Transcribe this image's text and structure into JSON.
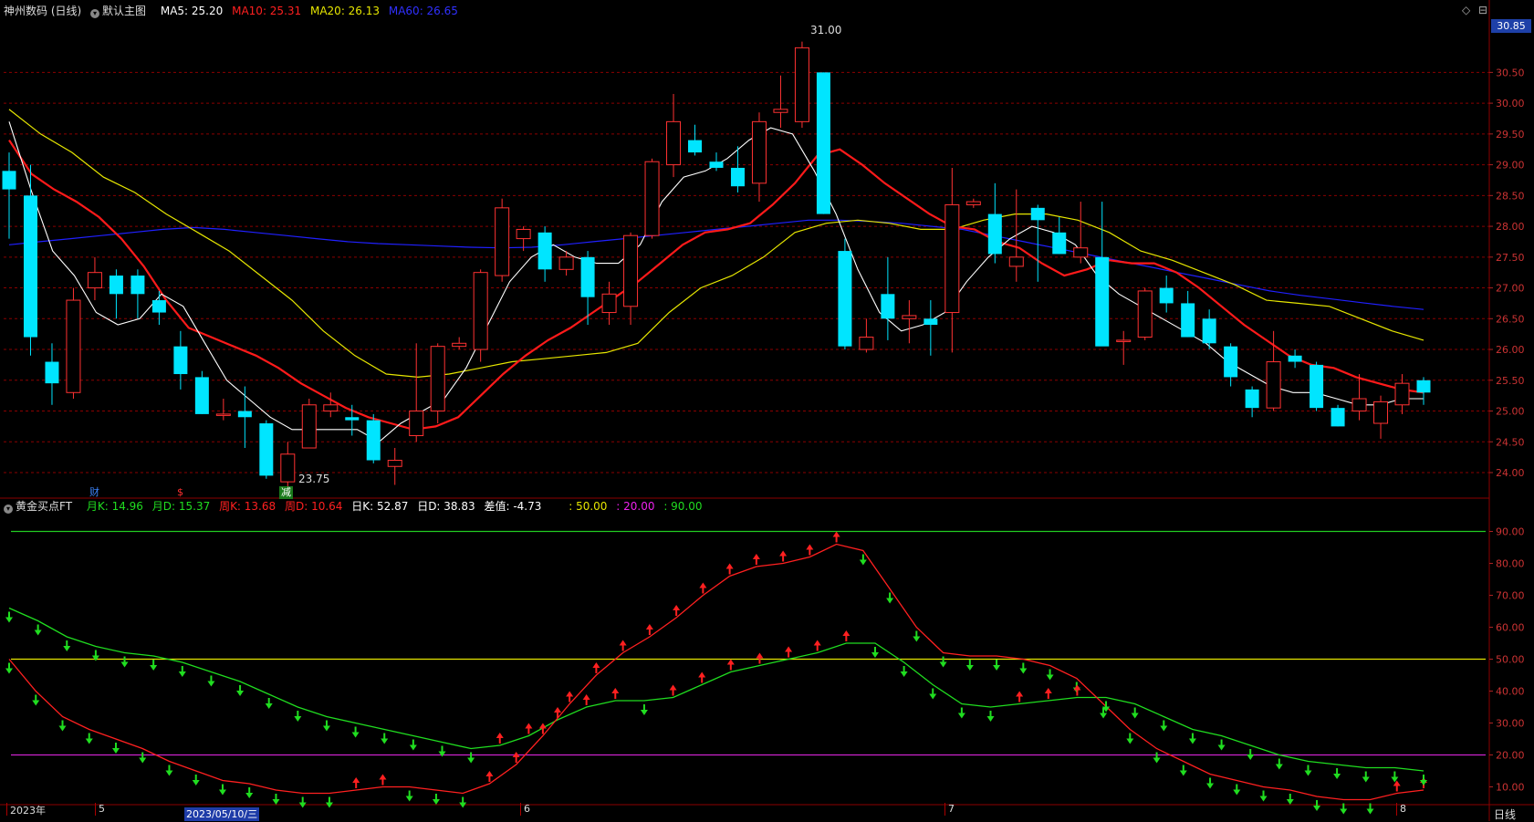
{
  "header": {
    "stock_name": "神州数码 (日线)",
    "main_chart_label": "默认主图",
    "ma5": "MA5: 25.20",
    "ma10": "MA10: 25.31",
    "ma20": "MA20: 26.13",
    "ma60": "MA60: 26.65"
  },
  "indicator_legend": {
    "name": "黄金买点FT",
    "monthly_k": "月K: 14.96",
    "monthly_d": "月D: 15.37",
    "weekly_k": "周K: 13.68",
    "weekly_d": "周D: 10.64",
    "daily_k": "日K: 52.87",
    "daily_d": "日D: 38.83",
    "diff": "差值: -4.73",
    "lvl50": ": 50.00",
    "lvl20": ": 20.00",
    "lvl90": ": 90.00"
  },
  "right_panel": {
    "current_price": "30.85",
    "period": "日线",
    "top_icons": [
      "◇",
      "⊟"
    ]
  },
  "annotations": {
    "high_label": "31.00",
    "low_label": "23.75",
    "badges": [
      {
        "text": "财",
        "color": "#3b82f6"
      },
      {
        "text": "$",
        "color": "#ff3030"
      },
      {
        "text": "减",
        "color": "#22cc22"
      }
    ]
  },
  "time_axis": {
    "labels": [
      "2023年",
      "5",
      "6",
      "7",
      "8"
    ],
    "selected_date": "2023/05/10/三"
  },
  "colors": {
    "up": "#ff3232",
    "down": "#00e5ff",
    "ma5": "#ffffff",
    "ma10": "#ff1a1a",
    "ma20": "#e6e600",
    "ma60": "#2020ff",
    "kd_red": "#ff2020",
    "kd_green": "#20dd20",
    "level50": "#e6e600",
    "level20": "#cc22cc",
    "level90": "#22cc22",
    "grid": "#8b0000"
  },
  "chart_data": [
    {
      "type": "candlestick",
      "title": "神州数码 (日线)",
      "price_axis_ticks": [
        24.0,
        24.5,
        25.0,
        25.5,
        26.0,
        26.5,
        27.0,
        27.5,
        28.0,
        28.5,
        29.0,
        29.5,
        30.0,
        30.5
      ],
      "ylim": [
        23.6,
        31.35
      ],
      "candles": [
        {
          "o": 28.9,
          "h": 29.2,
          "l": 27.8,
          "c": 28.6
        },
        {
          "o": 28.5,
          "h": 29.0,
          "l": 25.9,
          "c": 26.2
        },
        {
          "o": 25.8,
          "h": 26.1,
          "l": 25.1,
          "c": 25.45
        },
        {
          "o": 25.3,
          "h": 27.0,
          "l": 25.2,
          "c": 26.8
        },
        {
          "o": 27.0,
          "h": 27.5,
          "l": 26.8,
          "c": 27.25
        },
        {
          "o": 27.2,
          "h": 27.3,
          "l": 26.5,
          "c": 26.9
        },
        {
          "o": 27.2,
          "h": 27.3,
          "l": 26.5,
          "c": 26.9
        },
        {
          "o": 26.8,
          "h": 26.95,
          "l": 26.4,
          "c": 26.6
        },
        {
          "o": 26.05,
          "h": 26.3,
          "l": 25.35,
          "c": 25.6
        },
        {
          "o": 25.55,
          "h": 25.65,
          "l": 24.95,
          "c": 24.95
        },
        {
          "o": 24.95,
          "h": 25.2,
          "l": 24.85,
          "c": 24.95
        },
        {
          "o": 25.0,
          "h": 25.4,
          "l": 24.4,
          "c": 24.9
        },
        {
          "o": 24.8,
          "h": 24.85,
          "l": 23.9,
          "c": 23.95
        },
        {
          "o": 23.85,
          "h": 24.5,
          "l": 23.75,
          "c": 24.3
        },
        {
          "o": 24.4,
          "h": 25.2,
          "l": 24.4,
          "c": 25.1
        },
        {
          "o": 25.0,
          "h": 25.3,
          "l": 24.9,
          "c": 25.1
        },
        {
          "o": 24.9,
          "h": 25.1,
          "l": 24.6,
          "c": 24.85
        },
        {
          "o": 24.85,
          "h": 24.95,
          "l": 24.15,
          "c": 24.2
        },
        {
          "o": 24.1,
          "h": 24.4,
          "l": 23.8,
          "c": 24.2
        },
        {
          "o": 24.6,
          "h": 26.1,
          "l": 24.5,
          "c": 25.0
        },
        {
          "o": 25.0,
          "h": 26.1,
          "l": 24.8,
          "c": 26.05
        },
        {
          "o": 26.05,
          "h": 26.2,
          "l": 26.0,
          "c": 26.1
        },
        {
          "o": 26.0,
          "h": 27.3,
          "l": 25.8,
          "c": 27.25
        },
        {
          "o": 27.2,
          "h": 28.45,
          "l": 27.1,
          "c": 28.3
        },
        {
          "o": 27.8,
          "h": 28.0,
          "l": 27.6,
          "c": 27.95
        },
        {
          "o": 27.9,
          "h": 28.0,
          "l": 27.1,
          "c": 27.3
        },
        {
          "o": 27.3,
          "h": 27.6,
          "l": 27.2,
          "c": 27.5
        },
        {
          "o": 27.5,
          "h": 27.6,
          "l": 26.4,
          "c": 26.85
        },
        {
          "o": 26.6,
          "h": 27.1,
          "l": 26.4,
          "c": 26.9
        },
        {
          "o": 26.7,
          "h": 27.9,
          "l": 26.4,
          "c": 27.85
        },
        {
          "o": 27.85,
          "h": 29.1,
          "l": 27.8,
          "c": 29.05
        },
        {
          "o": 29.0,
          "h": 30.15,
          "l": 28.8,
          "c": 29.7
        },
        {
          "o": 29.4,
          "h": 29.65,
          "l": 29.15,
          "c": 29.2
        },
        {
          "o": 29.05,
          "h": 29.2,
          "l": 28.9,
          "c": 28.95
        },
        {
          "o": 28.95,
          "h": 29.3,
          "l": 28.55,
          "c": 28.65
        },
        {
          "o": 28.7,
          "h": 29.85,
          "l": 28.4,
          "c": 29.7
        },
        {
          "o": 29.85,
          "h": 30.45,
          "l": 29.6,
          "c": 29.9
        },
        {
          "o": 29.7,
          "h": 31.0,
          "l": 29.6,
          "c": 30.9
        },
        {
          "o": 30.5,
          "h": 30.5,
          "l": 28.2,
          "c": 28.2
        },
        {
          "o": 27.6,
          "h": 27.8,
          "l": 26.0,
          "c": 26.05
        },
        {
          "o": 26.0,
          "h": 26.5,
          "l": 25.95,
          "c": 26.2
        },
        {
          "o": 26.9,
          "h": 27.5,
          "l": 26.15,
          "c": 26.5
        },
        {
          "o": 26.5,
          "h": 26.8,
          "l": 26.1,
          "c": 26.55
        },
        {
          "o": 26.5,
          "h": 26.8,
          "l": 25.9,
          "c": 26.4
        },
        {
          "o": 26.6,
          "h": 28.95,
          "l": 25.95,
          "c": 28.35
        },
        {
          "o": 28.35,
          "h": 28.45,
          "l": 28.3,
          "c": 28.4
        },
        {
          "o": 28.2,
          "h": 28.7,
          "l": 27.4,
          "c": 27.55
        },
        {
          "o": 27.35,
          "h": 28.6,
          "l": 27.1,
          "c": 27.5
        },
        {
          "o": 28.3,
          "h": 28.35,
          "l": 27.1,
          "c": 28.1
        },
        {
          "o": 27.9,
          "h": 28.15,
          "l": 27.55,
          "c": 27.55
        },
        {
          "o": 27.5,
          "h": 28.4,
          "l": 27.4,
          "c": 27.65
        },
        {
          "o": 27.5,
          "h": 28.4,
          "l": 27.4,
          "c": 26.05
        },
        {
          "o": 26.15,
          "h": 26.3,
          "l": 25.75,
          "c": 26.15
        },
        {
          "o": 26.2,
          "h": 27.0,
          "l": 26.15,
          "c": 26.95
        },
        {
          "o": 27.0,
          "h": 27.2,
          "l": 26.6,
          "c": 26.75
        },
        {
          "o": 26.75,
          "h": 26.95,
          "l": 26.2,
          "c": 26.2
        },
        {
          "o": 26.5,
          "h": 26.65,
          "l": 26.0,
          "c": 26.1
        },
        {
          "o": 26.05,
          "h": 26.1,
          "l": 25.4,
          "c": 25.55
        },
        {
          "o": 25.35,
          "h": 25.4,
          "l": 24.9,
          "c": 25.05
        },
        {
          "o": 25.05,
          "h": 26.3,
          "l": 25.0,
          "c": 25.8
        },
        {
          "o": 25.9,
          "h": 26.0,
          "l": 25.7,
          "c": 25.8
        },
        {
          "o": 25.75,
          "h": 25.8,
          "l": 25.0,
          "c": 25.05
        },
        {
          "o": 25.05,
          "h": 25.1,
          "l": 24.75,
          "c": 24.75
        },
        {
          "o": 25.0,
          "h": 25.6,
          "l": 24.85,
          "c": 25.2
        },
        {
          "o": 24.8,
          "h": 25.25,
          "l": 24.55,
          "c": 25.15
        },
        {
          "o": 25.1,
          "h": 25.6,
          "l": 24.95,
          "c": 25.45
        },
        {
          "o": 25.5,
          "h": 25.55,
          "l": 25.1,
          "c": 25.3
        }
      ],
      "ma5": [
        29.7,
        28.6,
        27.6,
        27.2,
        26.6,
        26.4,
        26.5,
        26.9,
        26.7,
        26.1,
        25.5,
        25.2,
        24.9,
        24.7,
        24.7,
        24.7,
        24.7,
        24.5,
        24.8,
        25.0,
        25.2,
        25.7,
        26.4,
        27.1,
        27.5,
        27.7,
        27.5,
        27.4,
        27.4,
        27.7,
        28.4,
        28.8,
        28.9,
        29.1,
        29.4,
        29.6,
        29.5,
        28.9,
        28.2,
        27.3,
        26.6,
        26.3,
        26.4,
        26.6,
        27.1,
        27.5,
        27.8,
        28.0,
        27.9,
        27.7,
        27.2,
        26.9,
        26.7,
        26.5,
        26.3,
        26.1,
        25.8,
        25.6,
        25.4,
        25.3,
        25.3,
        25.2,
        25.1,
        25.1,
        25.2,
        25.2
      ],
      "ma10": [
        29.4,
        28.85,
        28.6,
        28.4,
        28.15,
        27.8,
        27.35,
        26.8,
        26.35,
        26.2,
        26.05,
        25.9,
        25.7,
        25.45,
        25.25,
        25.05,
        24.9,
        24.8,
        24.7,
        24.75,
        24.9,
        25.25,
        25.6,
        25.9,
        26.15,
        26.35,
        26.6,
        26.85,
        27.1,
        27.4,
        27.7,
        27.9,
        27.95,
        28.05,
        28.35,
        28.7,
        29.15,
        29.25,
        29.0,
        28.7,
        28.45,
        28.2,
        28.0,
        27.95,
        27.75,
        27.65,
        27.4,
        27.2,
        27.3,
        27.45,
        27.4,
        27.4,
        27.25,
        27.0,
        26.7,
        26.4,
        26.15,
        25.9,
        25.75,
        25.7,
        25.55,
        25.45,
        25.35,
        25.3
      ],
      "ma20": [
        29.9,
        29.5,
        29.2,
        28.8,
        28.55,
        28.2,
        27.9,
        27.6,
        27.2,
        26.8,
        26.3,
        25.9,
        25.6,
        25.55,
        25.6,
        25.7,
        25.8,
        25.85,
        25.9,
        25.95,
        26.1,
        26.6,
        27.0,
        27.2,
        27.5,
        27.9,
        28.05,
        28.1,
        28.05,
        27.95,
        27.95,
        28.1,
        28.2,
        28.2,
        28.1,
        27.9,
        27.6,
        27.45,
        27.25,
        27.05,
        26.8,
        26.75,
        26.7,
        26.5,
        26.3,
        26.15
      ],
      "ma60": [
        27.7,
        27.75,
        27.8,
        27.85,
        27.9,
        27.95,
        27.98,
        27.95,
        27.9,
        27.85,
        27.8,
        27.75,
        27.72,
        27.7,
        27.68,
        27.66,
        27.65,
        27.66,
        27.7,
        27.75,
        27.8,
        27.85,
        27.9,
        27.95,
        28.0,
        28.05,
        28.1,
        28.1,
        28.08,
        28.05,
        28.0,
        27.95,
        27.85,
        27.75,
        27.65,
        27.55,
        27.45,
        27.35,
        27.25,
        27.15,
        27.05,
        26.95,
        26.88,
        26.82,
        26.76,
        26.7,
        26.65
      ]
    },
    {
      "type": "line",
      "title": "黄金买点FT",
      "ylim": [
        5,
        95
      ],
      "axis_ticks": [
        10,
        20,
        30,
        40,
        50,
        60,
        70,
        80,
        90
      ],
      "levels": [
        50,
        20,
        90
      ],
      "series": [
        {
          "name": "日K",
          "values": [
            50,
            40,
            32,
            28,
            25,
            22,
            18,
            15,
            12,
            11,
            9,
            8,
            8,
            9,
            10,
            10,
            9,
            8,
            11,
            17,
            26,
            36,
            45,
            52,
            57,
            63,
            70,
            76,
            79,
            80,
            82,
            86,
            84,
            72,
            60,
            52,
            51,
            51,
            50,
            48,
            44,
            36,
            28,
            22,
            18,
            14,
            12,
            10,
            9,
            7,
            6,
            6,
            8,
            9
          ]
        },
        {
          "name": "日D",
          "values": [
            66,
            62,
            57,
            54,
            52,
            51,
            49,
            46,
            43,
            39,
            35,
            32,
            30,
            28,
            26,
            24,
            22,
            23,
            26,
            31,
            35,
            37,
            37,
            38,
            42,
            46,
            48,
            50,
            52,
            55,
            55,
            49,
            42,
            36,
            35,
            36,
            37,
            38,
            38,
            36,
            32,
            28,
            26,
            23,
            20,
            18,
            17,
            16,
            16,
            15
          ]
        }
      ]
    }
  ]
}
